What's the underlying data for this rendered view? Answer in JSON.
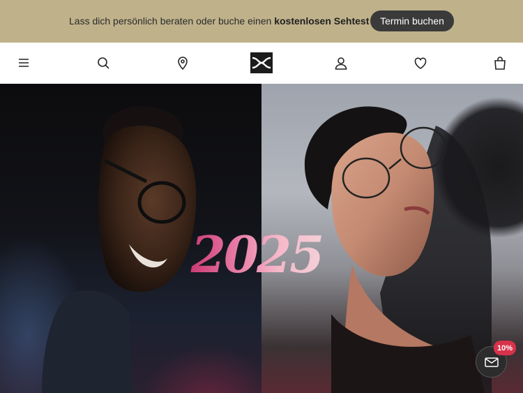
{
  "promo": {
    "text_regular": "Lass dich persönlich beraten oder buche einen ",
    "text_bold": "kostenlosen Sehtest",
    "button_label": "Termin buchen"
  },
  "nav": {
    "icons": [
      "menu-icon",
      "search-icon",
      "location-pin-icon",
      "brand-logo",
      "user-icon",
      "heart-icon",
      "shopping-bag-icon"
    ]
  },
  "hero": {
    "title": "2025"
  },
  "newsletter": {
    "badge": "10%"
  },
  "colors": {
    "promo_background": "#bfb28b",
    "promo_button": "#3a3a3a",
    "badge": "#d8324a",
    "title_gradient_start": "#c9356f",
    "title_gradient_end": "#f4d2d9"
  }
}
